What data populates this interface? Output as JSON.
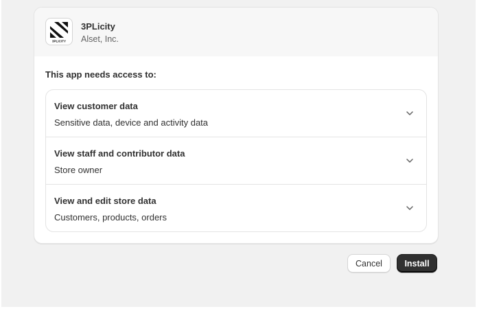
{
  "app": {
    "name": "3PLicity",
    "developer": "Alset, Inc.",
    "logo_text": "3PLICITY",
    "logo_icon": "3plicity-logo-icon"
  },
  "access": {
    "title": "This app needs access to:",
    "items": [
      {
        "title": "View customer data",
        "description": "Sensitive data, device and activity data"
      },
      {
        "title": "View staff and contributor data",
        "description": "Store owner"
      },
      {
        "title": "View and edit store data",
        "description": "Customers, products, orders"
      }
    ]
  },
  "buttons": {
    "cancel": "Cancel",
    "install": "Install"
  },
  "colors": {
    "primary_button": "#303030",
    "page_background": "#f1f1f1",
    "header_background": "#f7f7f7"
  }
}
